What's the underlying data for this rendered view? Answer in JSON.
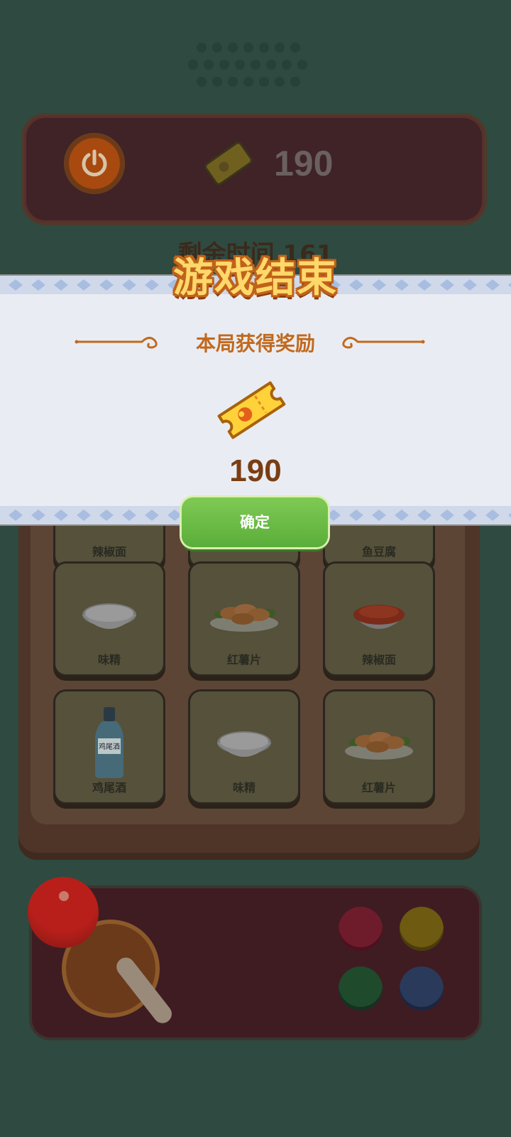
{
  "header": {
    "score": "190",
    "time_label": "剩余时间 161"
  },
  "board": {
    "tiles": [
      {
        "label": "辣椒面",
        "icon": "chili-powder-icon"
      },
      {
        "label": "",
        "icon": "hidden-tile"
      },
      {
        "label": "鱼豆腐",
        "icon": "fish-tofu-icon"
      },
      {
        "label": "味精",
        "icon": "msg-bowl-icon"
      },
      {
        "label": "红薯片",
        "icon": "sweet-potato-chips-icon"
      },
      {
        "label": "辣椒面",
        "icon": "chili-powder-icon"
      },
      {
        "label": "鸡尾酒",
        "icon": "cocktail-bottle-icon",
        "bottle_text": "鸡尾酒"
      },
      {
        "label": "味精",
        "icon": "msg-bowl-icon"
      },
      {
        "label": "红薯片",
        "icon": "sweet-potato-chips-icon"
      }
    ]
  },
  "dialog": {
    "title": "游戏结束",
    "subtitle": "本局获得奖励",
    "reward_value": "190",
    "confirm_label": "确定"
  },
  "colors": {
    "background": "#2f4a40",
    "title_fill": "#ffd86a",
    "title_outline": "#c0621a",
    "confirm_button": "#6cbc47",
    "reward_text": "#7a3d12"
  }
}
